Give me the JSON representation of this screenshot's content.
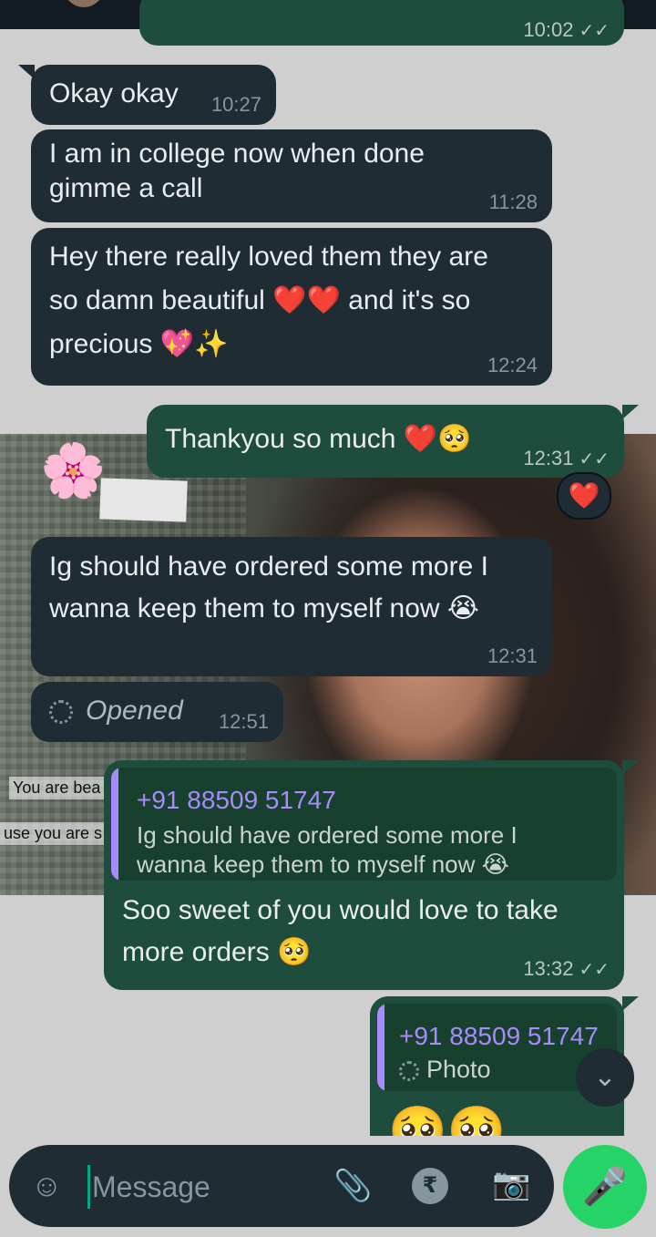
{
  "messages": {
    "m0_time": "10:02",
    "m1": {
      "text": "Okay okay",
      "time": "10:27"
    },
    "m2": {
      "line1": "I am in college now when done",
      "line2": "gimme a call",
      "time": "11:28"
    },
    "m3": {
      "line1": "Hey there really loved them they are",
      "line2a": "so damn beautiful",
      "line2b": "and it's so",
      "line3": "precious",
      "time": "12:24"
    },
    "m4": {
      "text": "Thankyou so much",
      "time": "12:31",
      "reaction": "❤️"
    },
    "m5": {
      "line1": "Ig should have ordered some more I",
      "line2": "wanna keep them to myself now",
      "time": "12:31"
    },
    "m6": {
      "text": "Opened",
      "time": "12:51"
    },
    "m7": {
      "quote_name": "+91 88509 51747",
      "quote_line1": "Ig should have ordered some more I",
      "quote_line2": "wanna keep them to myself now",
      "line1": "Soo sweet of you would love to take",
      "line2": "more orders",
      "time": "13:32"
    },
    "m8": {
      "quote_name": "+91 88509 51747",
      "quote_text": "Photo"
    }
  },
  "story_overlay": {
    "line1": "You are bea",
    "line2": "use you are s"
  },
  "composer": {
    "placeholder": "Message"
  },
  "icons": {
    "emoji": "emoji-icon",
    "attach": "paperclip-icon",
    "payment": "rupee-icon",
    "camera": "camera-icon",
    "mic": "mic-icon",
    "scroll": "chevron-double-down-icon",
    "view_once": "view-once-icon"
  },
  "colors": {
    "incoming": "#1f2c34",
    "outgoing": "#1e4d3d",
    "accent": "#25d366",
    "quote_name": "#a78bfa"
  }
}
